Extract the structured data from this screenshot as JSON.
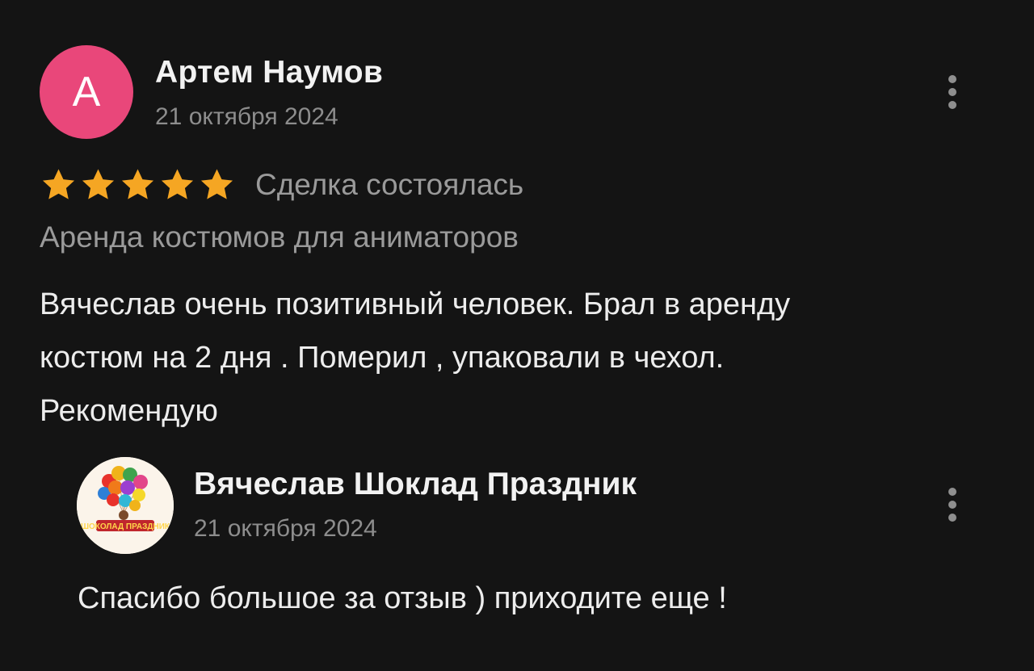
{
  "review": {
    "avatar_letter": "А",
    "avatar_color": "#e9477a",
    "author": "Артем Наумов",
    "date": "21 октября 2024",
    "rating": 5,
    "rating_max": 5,
    "star_color": "#f5a623",
    "deal_status": "Сделка состоялась",
    "category": "Аренда костюмов для аниматоров",
    "text_lines": [
      "Вячеслав очень позитивный человек. Брал в аренду",
      "костюм на 2 дня . Померил , упаковали в чехол.",
      "Рекомендую"
    ],
    "menu_icon": "more-vertical-icon"
  },
  "reply": {
    "author": "Вячеслав Шоклад Праздник",
    "logo_text": "ШОКОЛАД ПРАЗДНИК",
    "date": "21 октября 2024",
    "text": "Спасибо большое за отзыв ) приходите еще !",
    "menu_icon": "more-vertical-icon"
  }
}
